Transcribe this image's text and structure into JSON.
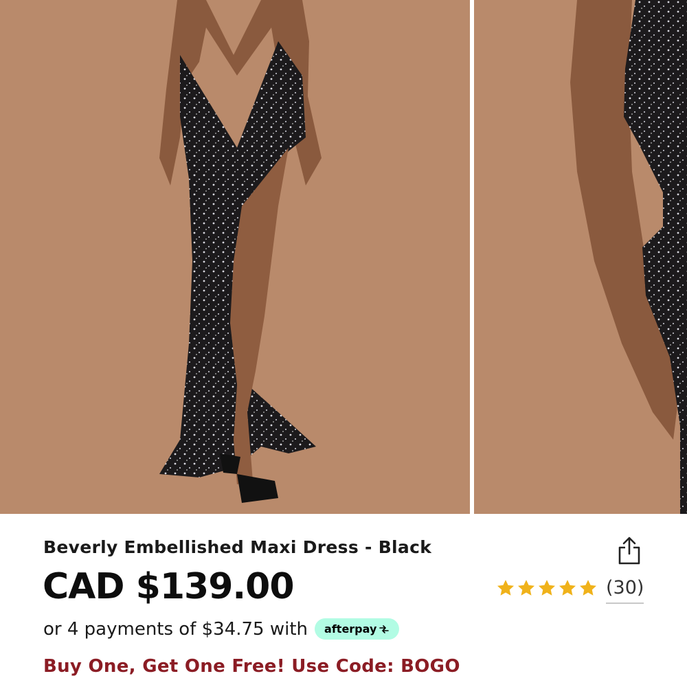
{
  "product": {
    "title": "Beverly Embellished Maxi Dress - Black",
    "price": "CAD $139.00",
    "installments_text": "or 4 payments of $34.75 with",
    "afterpay_label": "afterpay",
    "promo": "Buy One, Get One Free! Use Code: BOGO"
  },
  "rating": {
    "stars": 5,
    "count_label": "(30)"
  },
  "icons": {
    "share": "share-icon",
    "star": "star-icon",
    "afterpay_arrows": "afterpay-arrows-icon"
  },
  "colors": {
    "photo_background": "#b9896a",
    "star": "#f0b21a",
    "promo": "#8b1c24",
    "afterpay_badge": "#b2fce4"
  }
}
